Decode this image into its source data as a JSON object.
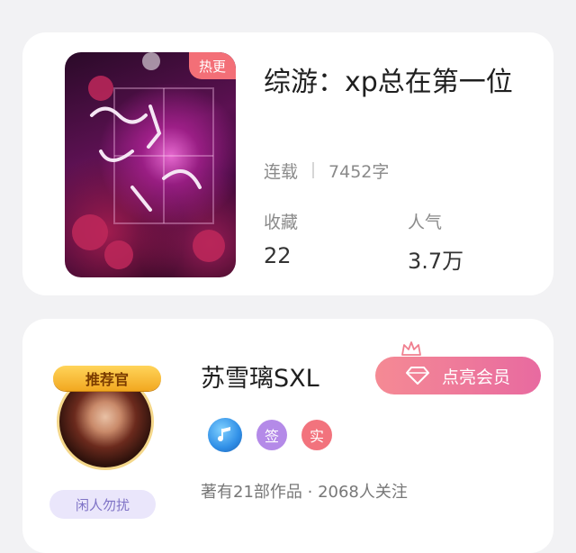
{
  "book": {
    "badge": "热更",
    "title": "综游：xp总在第一位",
    "status": "连载",
    "word_count": "7452字",
    "stats": [
      {
        "label": "收藏",
        "value": "22"
      },
      {
        "label": "人气",
        "value": "3.7万"
      }
    ]
  },
  "author": {
    "recommend_badge": "推荐官",
    "name": "苏雪璃SXL",
    "vip_button": "点亮会员",
    "badges": [
      {
        "icon": "music-note-icon",
        "color": "#2f8ee6"
      },
      {
        "label": "签",
        "color": "#b48ae8"
      },
      {
        "label": "实",
        "color": "#f2737d"
      }
    ],
    "status_tag": "闲人勿扰",
    "meta": "著有21部作品 · 2068人关注"
  }
}
